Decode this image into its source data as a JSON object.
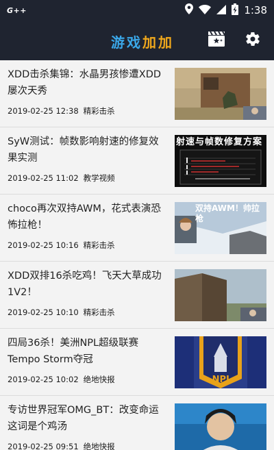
{
  "status_bar": {
    "carrier": "G++",
    "time": "1:38",
    "icons": [
      "location-icon",
      "wifi-icon",
      "signal-icon",
      "battery-charging-icon"
    ]
  },
  "app_bar": {
    "title_part1": "游戏",
    "title_part2": "加加",
    "actions": [
      "video-clapper-icon",
      "settings-gear-icon"
    ],
    "title_colors": {
      "part1": "#3aa7e8",
      "part2": "#f0a81c"
    },
    "background": "#1f2430"
  },
  "feed": {
    "items": [
      {
        "title": "XDD击杀集锦：水晶男孩惨遭XDD屡次天秀",
        "date": "2019-02-25 12:38",
        "category": "精彩击杀"
      },
      {
        "title": "SyW测试：帧数影响射速的修复效果实测",
        "date": "2019-02-25 11:02",
        "category": "教学视频",
        "thumb_text": "射速与帧数修复方案"
      },
      {
        "title": "choco再次双持AWM，花式表演恐怖拉枪！",
        "date": "2019-02-25 10:16",
        "category": "精彩击杀",
        "thumb_text": "双持AWM！帅拉枪"
      },
      {
        "title": "XDD双排16杀吃鸡！飞天大草成功1V2！",
        "date": "2019-02-25 10:10",
        "category": "精彩击杀"
      },
      {
        "title": "四局36杀！美洲NPL超级联赛Tempo Storm夺冠",
        "date": "2019-02-25 10:02",
        "category": "绝地快报",
        "thumb_text": "NPL"
      },
      {
        "title": "专访世界冠军OMG_BT：改变命运这词是个鸡汤",
        "date": "2019-02-25 09:51",
        "category": "绝地快报"
      }
    ]
  }
}
